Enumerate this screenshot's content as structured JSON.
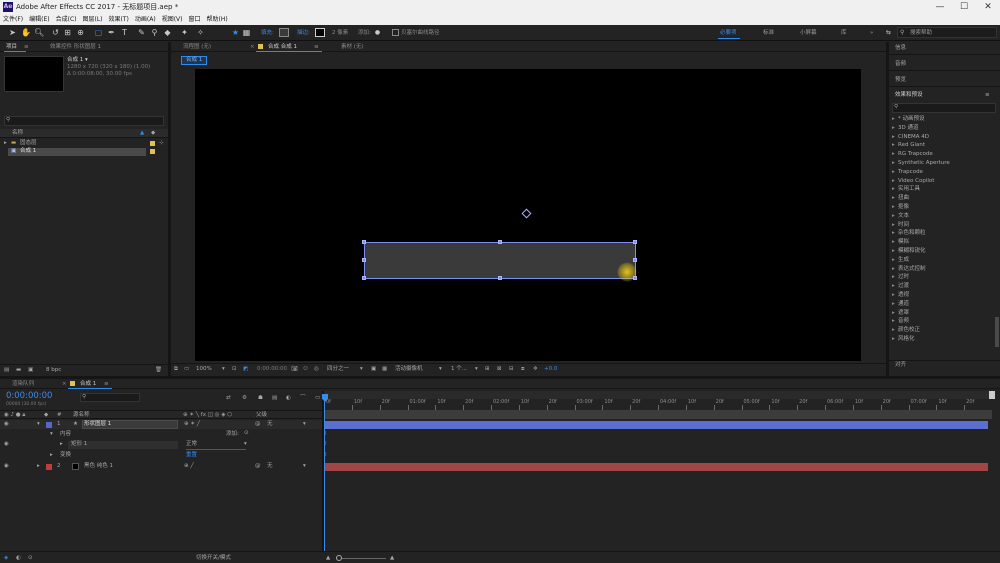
{
  "window": {
    "title": "Adobe After Effects CC 2017 - 无标题项目.aep *",
    "logo_text": "Ae"
  },
  "menu": [
    "文件(F)",
    "编辑(E)",
    "合成(C)",
    "图层(L)",
    "效果(T)",
    "动画(A)",
    "视图(V)",
    "窗口",
    "帮助(H)"
  ],
  "toolbar": {
    "fill_label": "填充:",
    "stroke_label": "描边:",
    "stroke_value": "2 像素",
    "add_label": "添加:",
    "bezier_label": "贝塞尔曲线路径",
    "workspaces": [
      "必要项",
      "标准",
      "小屏幕",
      "库"
    ],
    "search_placeholder": "搜索帮助"
  },
  "project_panel": {
    "tab_project": "项目",
    "tab_effect_controls": "效果控件 形状图层 1",
    "comp_name": "合成 1 ▾",
    "comp_info_line1": "1280 x 720 (320 x 180) (1.00)",
    "comp_info_line2": "Δ 0:00:08:00, 30.00 fps",
    "search_placeholder": "",
    "col_name": "名称",
    "items": [
      "固态层",
      "合成 1"
    ],
    "bpc": "8 bpc"
  },
  "comp_panel": {
    "tab_flow": "流程图 (无)",
    "tab_comp": "合成 合成 1",
    "tab_footage": "素材 (无)",
    "sub_tab": "合成 1",
    "zoom": "100%",
    "timecode": "0:00:00:00",
    "resolution": "四分之一",
    "camera": "活动摄像机",
    "views": "1 个...",
    "exposure": "+0.0"
  },
  "right_panel": {
    "sections": [
      "信息",
      "音频",
      "预览",
      "效果和预设"
    ],
    "effects": [
      "* 动画预设",
      "3D 通道",
      "CINEMA 4D",
      "Red Giant",
      "RG Trapcode",
      "Synthetic Aperture",
      "Trapcode",
      "Video Copilot",
      "实用工具",
      "扭曲",
      "抠像",
      "文本",
      "时间",
      "杂色和颗粒",
      "模拟",
      "模糊和锐化",
      "生成",
      "表达式控制",
      "过时",
      "过渡",
      "透视",
      "通道",
      "遮罩",
      "音频",
      "颜色校正",
      "风格化"
    ],
    "bottom_section": "对齐"
  },
  "timeline": {
    "tab_render": "渲染队列",
    "tab_comp": "合成 1",
    "timecode": "0:00:00:00",
    "timecode_sub": "00000 (30.00 fps)",
    "col_num": "#",
    "col_source": "源名称",
    "col_parent": "父级",
    "layers": [
      {
        "num": "1",
        "name": "形状图层 1",
        "parent": "无",
        "color": "#5567c9"
      },
      {
        "num": "2",
        "name": "黑色 纯色 1",
        "parent": "无",
        "color": "#c23b3b"
      }
    ],
    "contents_label": "内容",
    "add_label": "添加:",
    "rect_label": "矩形 1",
    "blend_mode": "正常",
    "transform_label": "变换",
    "reset_label": "重置",
    "ruler": [
      "0f",
      "10f",
      "20f",
      "01:00f",
      "10f",
      "20f",
      "02:00f",
      "10f",
      "20f",
      "03:00f",
      "10f",
      "20f",
      "04:00f",
      "10f",
      "20f",
      "05:00f",
      "10f",
      "20f",
      "06:00f",
      "10f",
      "20f",
      "07:00f",
      "10f",
      "20f"
    ],
    "toggle_label": "切换开关/模式",
    "bar_colors": {
      "layer1": "#5b6fd0",
      "layer2": "#a04646"
    }
  }
}
